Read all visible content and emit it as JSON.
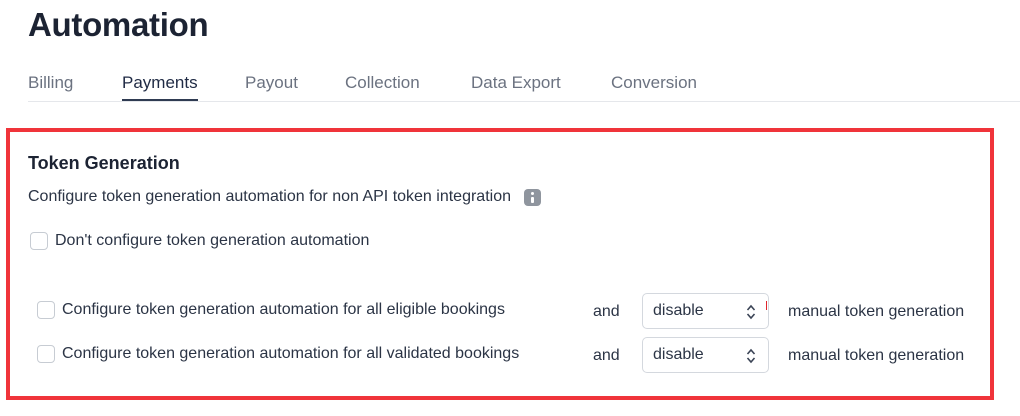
{
  "page": {
    "title": "Automation"
  },
  "tabs": [
    {
      "label": "Billing",
      "active": false
    },
    {
      "label": "Payments",
      "active": true
    },
    {
      "label": "Payout",
      "active": false
    },
    {
      "label": "Collection",
      "active": false
    },
    {
      "label": "Data Export",
      "active": false
    },
    {
      "label": "Conversion",
      "active": false
    }
  ],
  "section": {
    "title": "Token Generation",
    "description": "Configure token generation automation for non API token integration",
    "info_icon": "info-icon",
    "option_none": {
      "label": "Don't configure token generation automation",
      "checked": false
    },
    "option_eligible": {
      "label": "Configure token generation automation for all eligible bookings",
      "checked": false,
      "connector": "and",
      "select_value": "disable",
      "suffix": "manual token generation"
    },
    "option_validated": {
      "label": "Configure token generation automation for all validated bookings",
      "checked": false,
      "connector": "and",
      "select_value": "disable",
      "suffix": "manual token generation"
    }
  },
  "colors": {
    "highlight": "#f0343a",
    "active_tab_underline": "#2f3b52",
    "info_icon": "#8f959e"
  }
}
